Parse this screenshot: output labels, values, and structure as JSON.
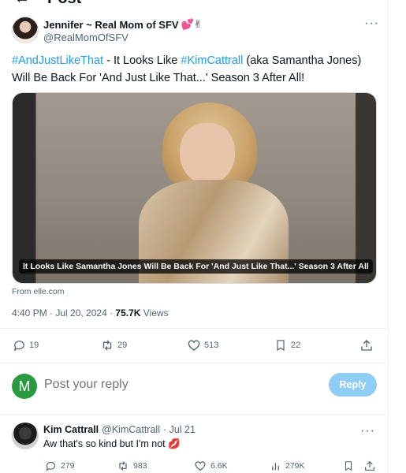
{
  "header": {
    "title": "Post"
  },
  "author": {
    "name": "Jennifer ~ Real Mom of SFV",
    "emoji": "💕✌",
    "handle": "@RealMomOfSFV"
  },
  "post": {
    "hashtag1": "#AndJustLikeThat",
    "text1": " - It Looks Like ",
    "hashtag2": "#KimCattrall",
    "text2": " (aka Samantha Jones) Will Be Back For 'And Just Like That...' Season 3 After All!",
    "card_caption": "It Looks Like Samantha Jones Will Be Back For 'And Just Like That...' Season 3 After All",
    "source": "From elle.com",
    "timestamp": "4:40 PM · Jul 20, 2024 · ",
    "views_count": "75.7K",
    "views_label": " Views"
  },
  "stats": {
    "replies": "19",
    "reposts": "29",
    "likes": "513",
    "bookmarks": "22"
  },
  "reply_box": {
    "avatar_letter": "M",
    "placeholder": "Post your reply",
    "button": "Reply",
    "avatar_color": "#2a9a40"
  },
  "reply": {
    "name": "Kim Cattrall",
    "handle": "@KimCattrall",
    "date": "· Jul 21",
    "text": "Aw that's so kind but I'm not 💋",
    "replies": "279",
    "reposts": "983",
    "likes": "6.6K",
    "views": "279K"
  },
  "colors": {
    "accent": "#1d9bf0",
    "muted": "#536471"
  }
}
